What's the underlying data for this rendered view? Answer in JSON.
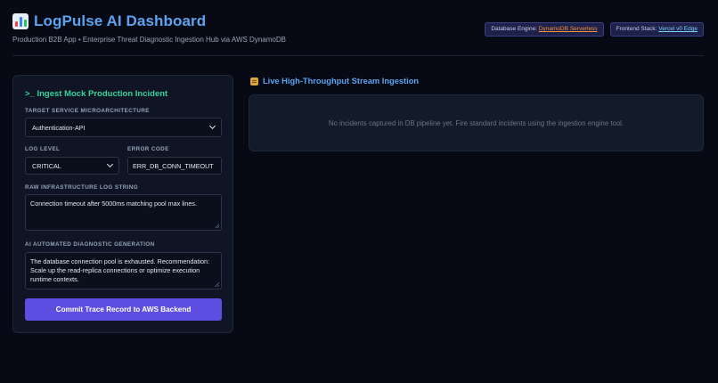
{
  "header": {
    "logo_icon": "bar-chart-icon",
    "title": "LogPulse AI Dashboard",
    "subtitle": "Production B2B App • Enterprise Threat Diagnostic Ingestion Hub via AWS DynamoDB",
    "badges": {
      "database_label": "Database Engine:",
      "database_value": "DynamoDB Serverless",
      "frontend_label": "Frontend Stack:",
      "frontend_value": "Vercel v0 Edge"
    }
  },
  "form": {
    "title": ">_ Ingest Mock Production Incident",
    "service": {
      "label": "Target Service Microarchitecture",
      "value": "Authentication-API"
    },
    "log_level": {
      "label": "Log Level",
      "value": "CRITICAL"
    },
    "error_code": {
      "label": "Error Code",
      "value": "ERR_DB_CONN_TIMEOUT"
    },
    "raw_log": {
      "label": "Raw Infrastructure Log String",
      "value": "Connection timeout after 5000ms matching pool max lines."
    },
    "ai_diagnostic": {
      "label": "AI Automated Diagnostic Generation",
      "value": "The database connection pool is exhausted. Recommendation: Scale up the read-replica connections or optimize execution runtime contexts."
    },
    "submit_label": "Commit Trace Record to AWS Backend"
  },
  "stream": {
    "icon": "log-icon",
    "title": "Live High-Throughput Stream Ingestion",
    "empty_message": "No incidents captured in DB pipeline yet. Fire standard incidents using the ingestion engine tool."
  },
  "colors": {
    "accent_blue": "#5ba4f0",
    "accent_green": "#34d399",
    "button_purple": "#5b4ee0",
    "background": "#070a14"
  }
}
